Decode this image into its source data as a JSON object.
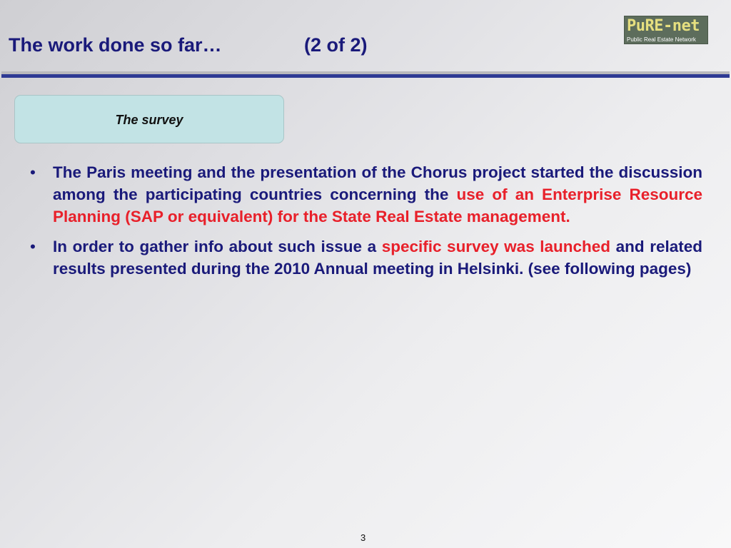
{
  "header": {
    "title": "The work done so far…",
    "page_indicator": "(2 of 2)"
  },
  "logo": {
    "name": "PuRE-net",
    "subtitle": "Public Real Estate Network"
  },
  "section": {
    "label": "The survey"
  },
  "bullets": [
    {
      "segments": [
        "The Paris meeting and the presentation of the Chorus project started the discussion among the participating countries concerning the ",
        "use of an Enterprise Resource Planning (SAP or equivalent) for the State Real Estate management."
      ]
    },
    {
      "segments": [
        "In order to gather info about such issue a ",
        "specific survey was launched",
        " and related results presented during the 2010 Annual meeting in Helsinki. (see following pages)"
      ]
    }
  ],
  "footer": {
    "page_number": "3"
  },
  "colors": {
    "title_blue": "#1a1a7a",
    "highlight_red": "#e8202a",
    "survey_box_fill": "#c2e3e5",
    "rule_blue": "#2e3a94",
    "logo_bg": "#5d6d5c",
    "logo_text": "#e6df7f"
  },
  "icons": {
    "bullet": "•"
  }
}
